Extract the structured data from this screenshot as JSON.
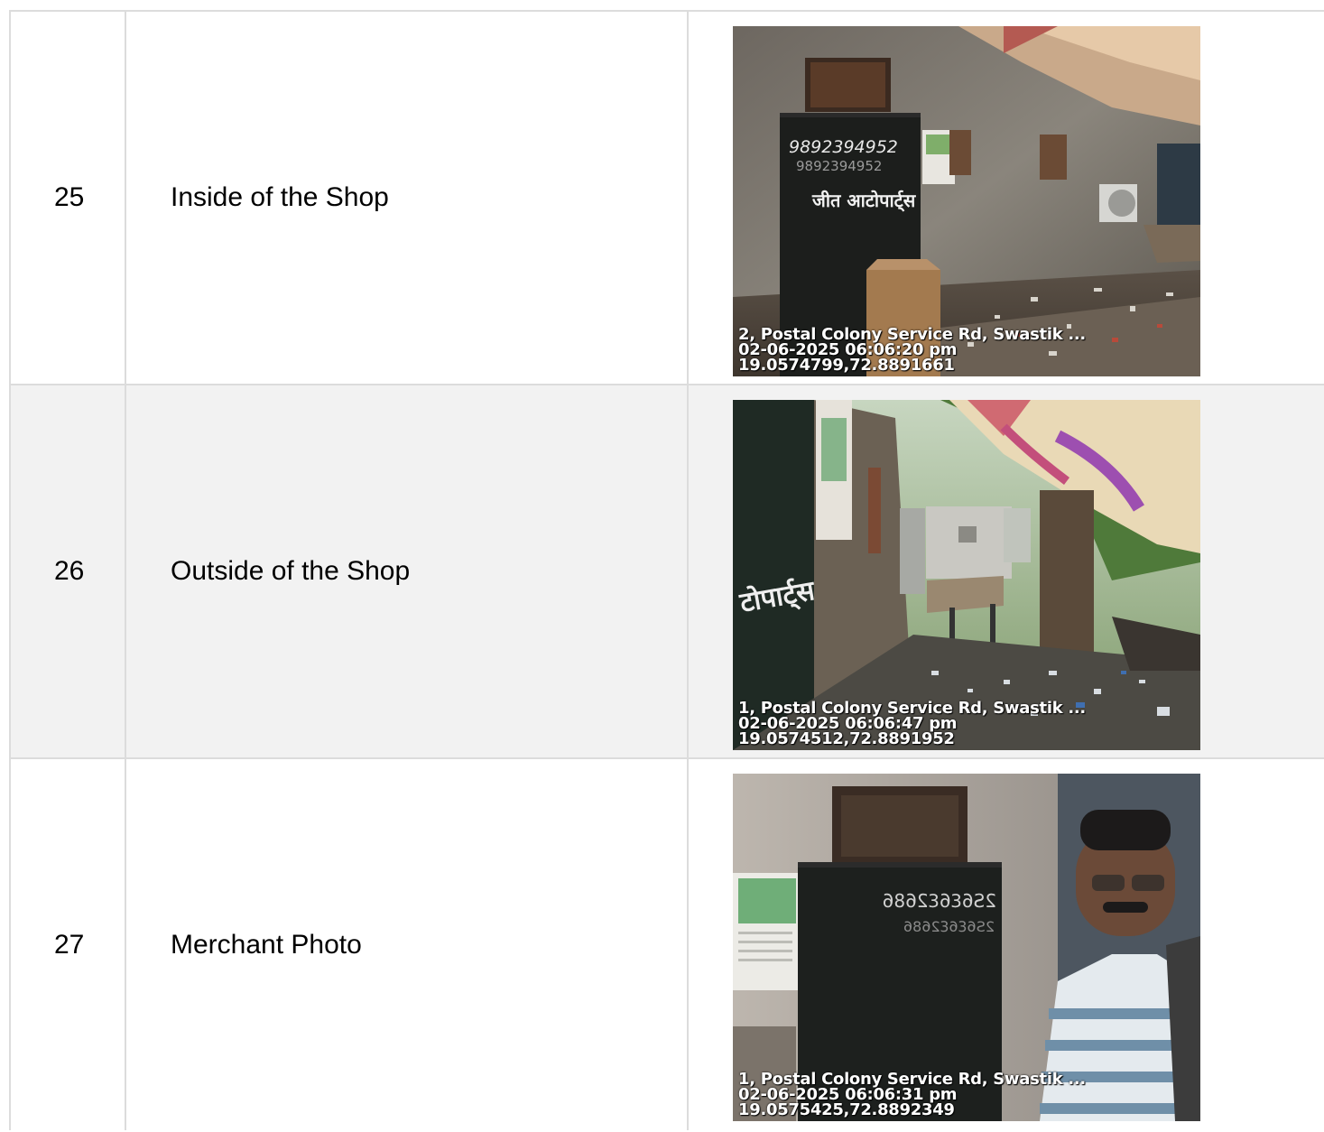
{
  "rows": [
    {
      "number": "25",
      "label": "Inside of the Shop",
      "photo": {
        "board_numbers": [
          "9892394952",
          "9892394952"
        ],
        "board_sign": "जीत आटोपार्ट्स",
        "stamp_address": "2, Postal Colony Service Rd, Swastik ...",
        "stamp_datetime": "02-06-2025 06:06:20 pm",
        "stamp_coords": "19.0574799,72.8891661"
      }
    },
    {
      "number": "26",
      "label": "Outside of the Shop",
      "photo": {
        "wall_sign": "टोपार्ट्स",
        "stamp_address": "1, Postal Colony Service Rd, Swastik ...",
        "stamp_datetime": "02-06-2025 06:06:47 pm",
        "stamp_coords": "19.0574512,72.8891952"
      }
    },
    {
      "number": "27",
      "label": "Merchant Photo",
      "photo": {
        "stamp_address": "1, Postal Colony Service Rd, Swastik ...",
        "stamp_datetime": "02-06-2025 06:06:31 pm",
        "stamp_coords": "19.0575425,72.8892349"
      }
    }
  ]
}
